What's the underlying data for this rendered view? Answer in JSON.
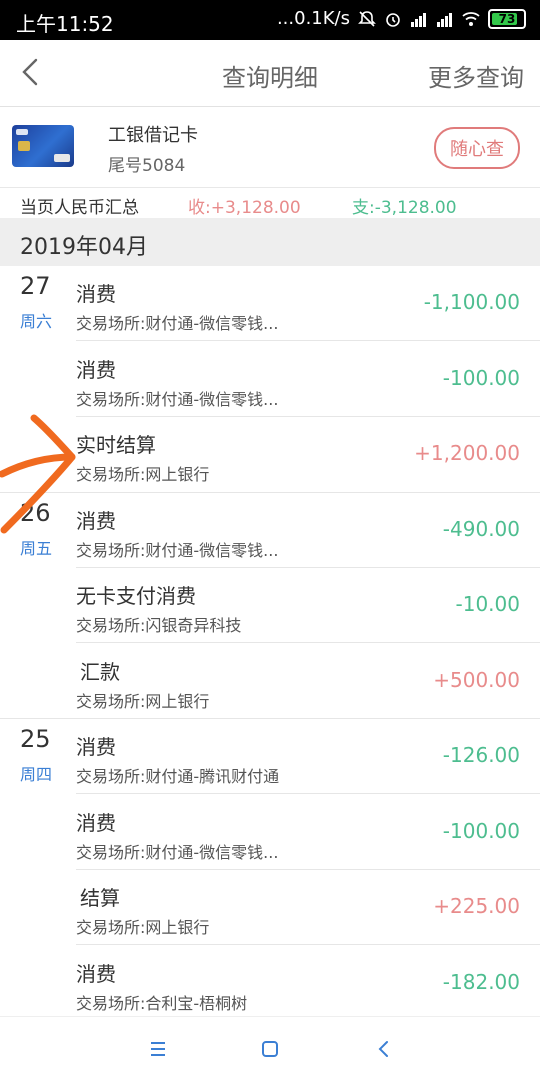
{
  "status": {
    "time": "上午11:52",
    "speed": "...0.1K/s",
    "battery": "73",
    "colors": {
      "battery": "#33c84a"
    }
  },
  "nav": {
    "title": "查询明细",
    "more": "更多查询"
  },
  "card": {
    "name": "工银借记卡",
    "tail": "尾号5084",
    "random_query": "随心查"
  },
  "summary": {
    "label": "当页人民币汇总",
    "income": "收:+3,128.00",
    "expense": "支:-3,128.00"
  },
  "month": "2019年04月",
  "groups": [
    {
      "day": "27",
      "week": "周六",
      "items": [
        {
          "title": "消费",
          "place": "交易场所:财付通-微信零钱...",
          "amount": "-1,100.00",
          "sign": "neg"
        },
        {
          "title": "消费",
          "place": "交易场所:财付通-微信零钱...",
          "amount": "-100.00",
          "sign": "neg"
        },
        {
          "title": "实时结算",
          "place": "交易场所:网上银行",
          "amount": "+1,200.00",
          "sign": "pos"
        }
      ]
    },
    {
      "day": "26",
      "week": "周五",
      "items": [
        {
          "title": "消费",
          "place": "交易场所:财付通-微信零钱...",
          "amount": "-490.00",
          "sign": "neg"
        },
        {
          "title": "无卡支付消费",
          "place": "交易场所:闪银奇异科技",
          "amount": "-10.00",
          "sign": "neg"
        },
        {
          "title": "汇款",
          "place": "交易场所:网上银行",
          "amount": "+500.00",
          "sign": "pos"
        }
      ]
    },
    {
      "day": "25",
      "week": "周四",
      "items": [
        {
          "title": "消费",
          "place": "交易场所:财付通-腾讯财付通",
          "amount": "-126.00",
          "sign": "neg"
        },
        {
          "title": "消费",
          "place": "交易场所:财付通-微信零钱...",
          "amount": "-100.00",
          "sign": "neg"
        },
        {
          "title": "结算",
          "place": "交易场所:网上银行",
          "amount": "+225.00",
          "sign": "pos"
        },
        {
          "title": "消费",
          "place": "交易场所:合利宝-梧桐树",
          "amount": "-182.00",
          "sign": "neg"
        }
      ]
    }
  ],
  "colors": {
    "income": "#e88b8b",
    "expense": "#4dbd8f",
    "weekday": "#3b7fd4",
    "button_border": "#e07b7b",
    "doodle": "#f06a1f"
  }
}
